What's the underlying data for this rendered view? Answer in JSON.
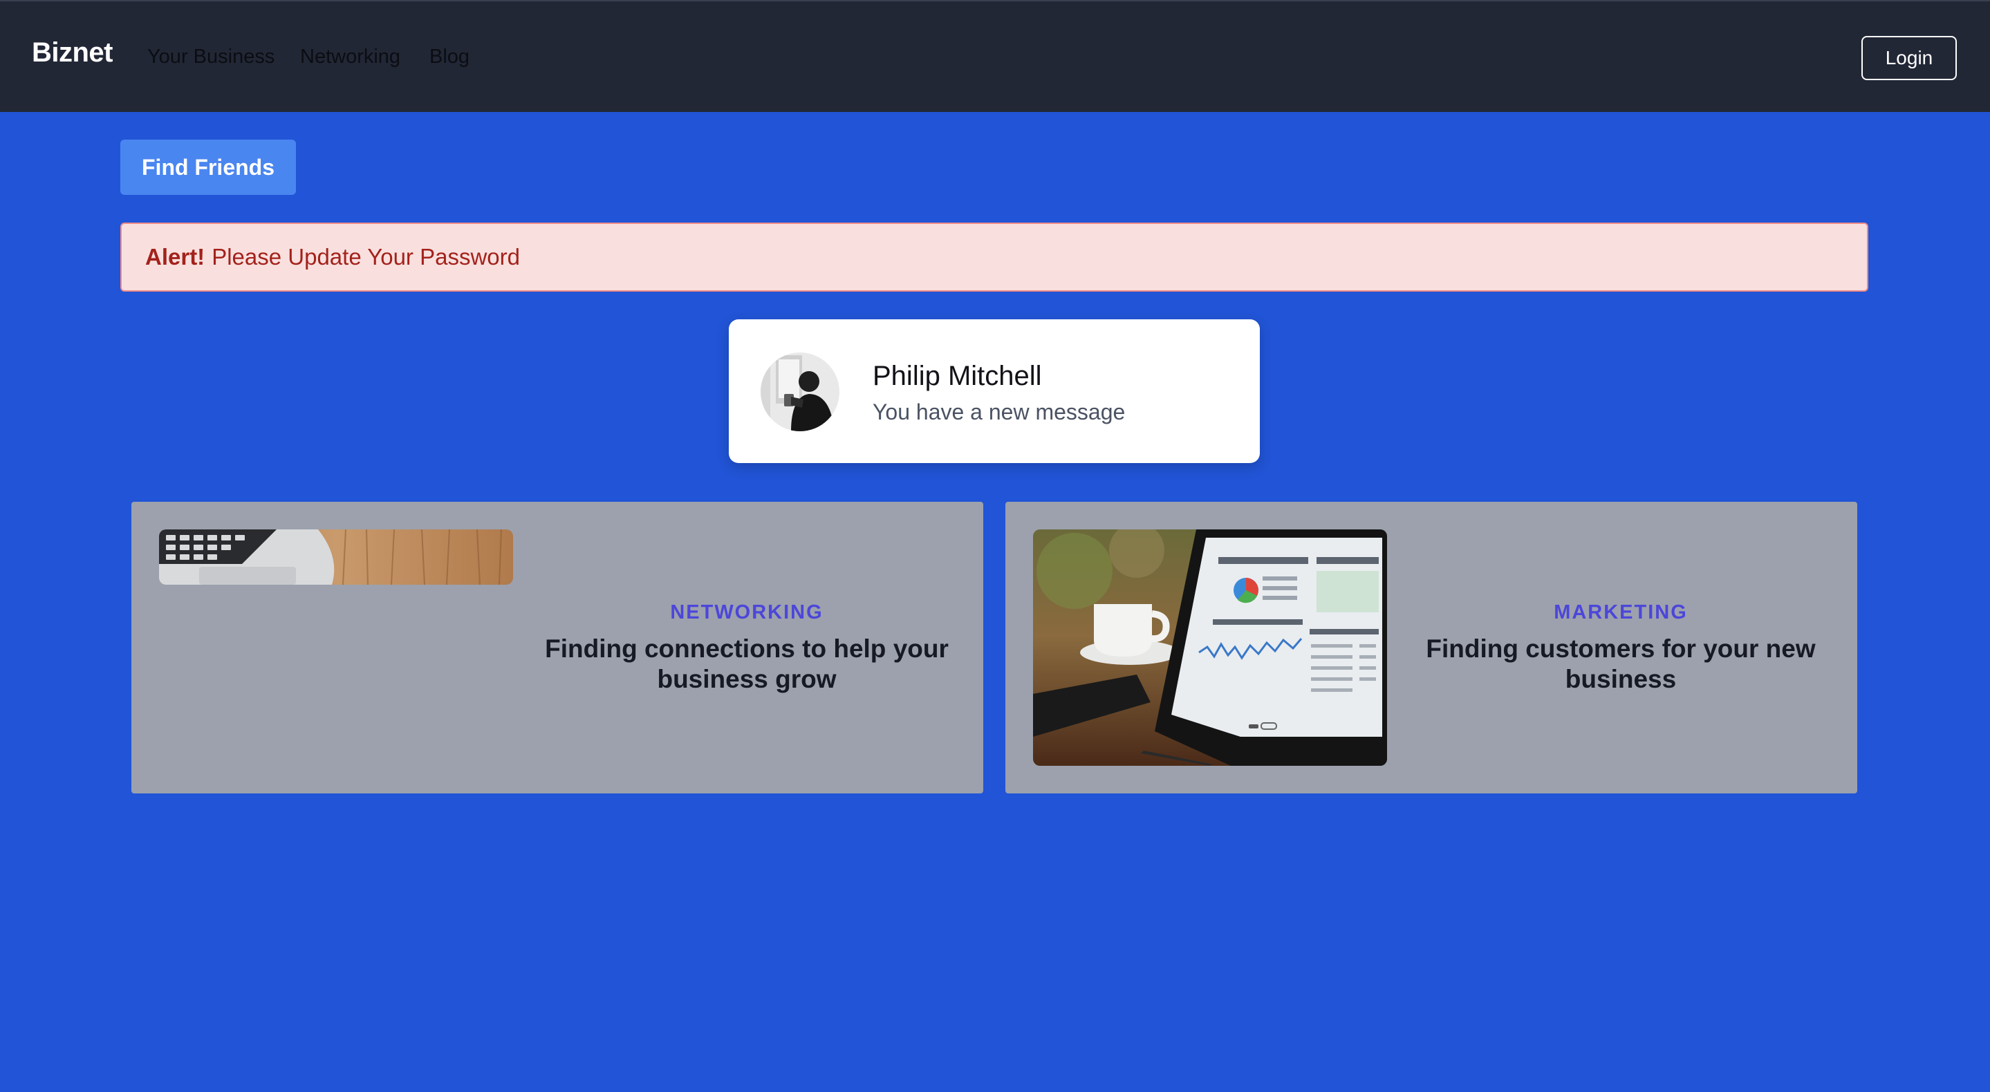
{
  "navbar": {
    "brand": "Biznet",
    "links": [
      "Your Business",
      "Networking",
      "Blog"
    ],
    "login_label": "Login"
  },
  "find_friends_label": "Find Friends",
  "alert": {
    "strong": "Alert!",
    "message": "Please Update Your Password"
  },
  "notification": {
    "name": "Philip Mitchell",
    "message": "You have a new message"
  },
  "cards": [
    {
      "category": "NETWORKING",
      "title": "Finding connections to help your business grow",
      "image": "laptop-on-wood-desk"
    },
    {
      "category": "MARKETING",
      "title": "Finding customers for your new business",
      "image": "tablet-with-analytics-dashboard"
    }
  ],
  "colors": {
    "page_background": "#2154d6",
    "navbar": "#222736",
    "button_primary": "#4a86f0",
    "alert_background": "#f9e0df",
    "alert_text": "#a3221b",
    "card_background": "#9ca1ad",
    "category_accent": "#4c46da"
  }
}
